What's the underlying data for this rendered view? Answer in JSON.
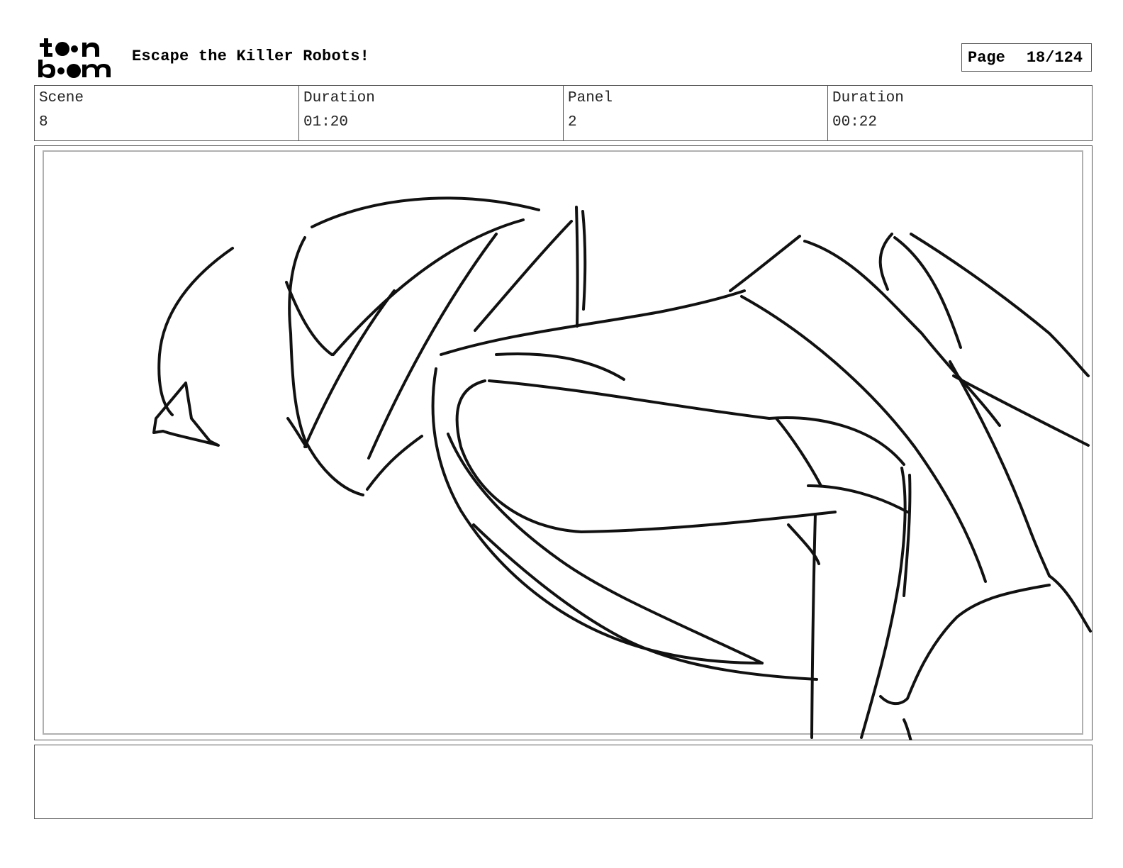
{
  "header": {
    "title": "Escape the Killer Robots!",
    "page_label": "Page",
    "page_value": "18/124"
  },
  "logo": {
    "icon": "toon-boom-logo",
    "text": "toon boom"
  },
  "info": {
    "scene_label": "Scene",
    "scene_value": "8",
    "scene_duration_label": "Duration",
    "scene_duration_value": "01:20",
    "panel_label": "Panel",
    "panel_value": "2",
    "panel_duration_label": "Duration",
    "panel_duration_value": "00:22"
  },
  "notes": {
    "text": ""
  },
  "colors": {
    "ink": "#111111",
    "frame": "#555555",
    "safe_area": "#b0b0b0"
  }
}
